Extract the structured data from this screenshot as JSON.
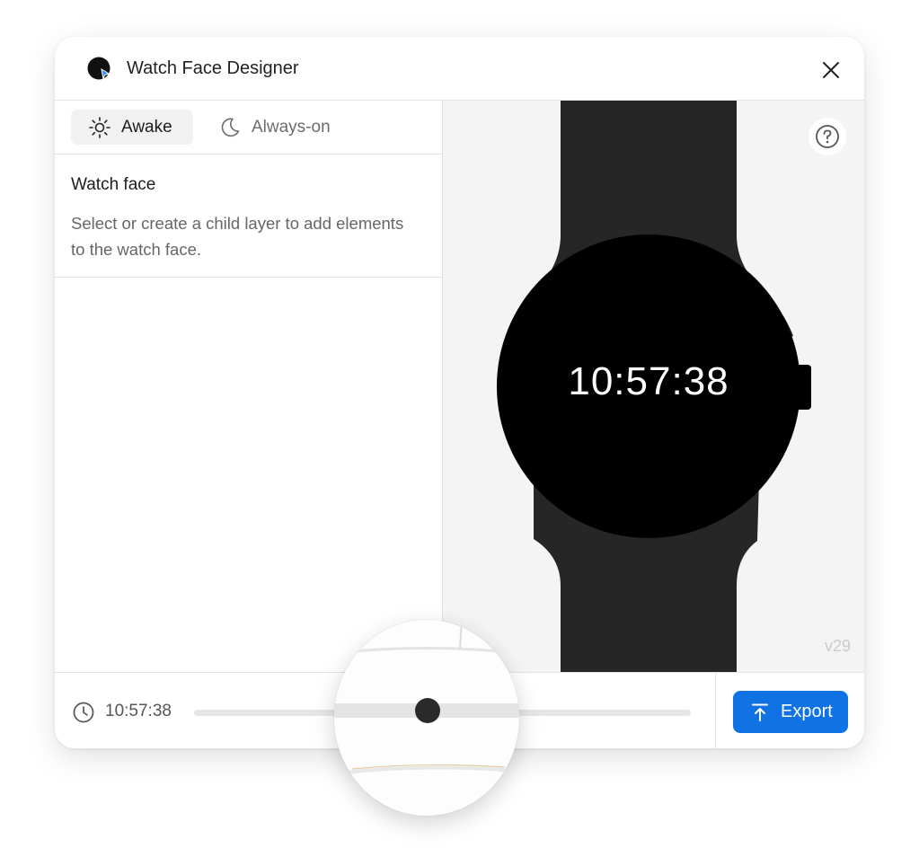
{
  "app": {
    "title": "Watch Face Designer",
    "logo_icon": "app-logo-icon",
    "close_icon": "close-icon"
  },
  "tabs": [
    {
      "label": "Awake",
      "icon": "sun-icon",
      "selected": true
    },
    {
      "label": "Always-on",
      "icon": "moon-icon",
      "selected": false
    }
  ],
  "layer_panel": {
    "title": "Watch face",
    "description": "Select or create a child layer to add elements to the watch face."
  },
  "preview": {
    "time": "10:57:38",
    "version": "v29",
    "help_icon": "help-icon"
  },
  "timeline": {
    "time": "10:57:38",
    "clock_icon": "clock-icon",
    "position_fraction": 0.47
  },
  "export": {
    "label": "Export",
    "icon": "upload-icon"
  },
  "colors": {
    "accent": "#1173e3",
    "strap": "#262626",
    "watch_face": "#000000",
    "preview_background": "#f4f4f4"
  }
}
